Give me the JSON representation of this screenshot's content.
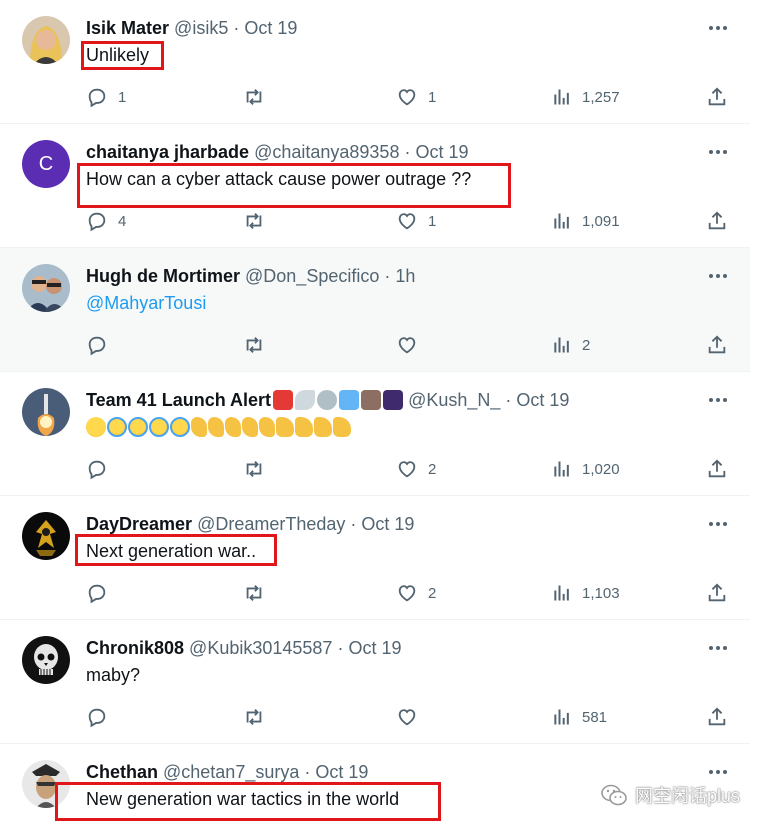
{
  "tweets": [
    {
      "name": "Isik Mater",
      "handle": "@isik5",
      "time": "Oct 19",
      "text": "Unlikely",
      "replies": "1",
      "retweets": "",
      "likes": "1",
      "views": "1,257",
      "avatar_icon": "profile-photo"
    },
    {
      "name": "chaitanya jharbade",
      "handle": "@chaitanya89358",
      "time": "Oct 19",
      "text": "How can a cyber attack cause power outrage ??",
      "replies": "4",
      "retweets": "",
      "likes": "1",
      "views": "1,091",
      "avatar_letter": "C",
      "avatar_color": "#5b2db2"
    },
    {
      "name": "Hugh de Mortimer",
      "handle": "@Don_Specifico",
      "time": "1h",
      "text": "@MahyarTousi",
      "replies": "",
      "retweets": "",
      "likes": "",
      "views": "2",
      "avatar_icon": "profile-photo"
    },
    {
      "name": "Team 41 Launch Alert",
      "name_emojis": [
        "rotating-light",
        "rocket",
        "satellite-dish",
        "satellite",
        "telescope",
        "milky-way"
      ],
      "handle": "@Kush_N_",
      "time": "Oct 19",
      "text_emojis": [
        "winking-face",
        "rofl",
        "rofl",
        "rofl",
        "rofl",
        "ok-hand",
        "ok-hand",
        "ok-hand",
        "ok-hand",
        "ok-hand",
        "thumbs-up",
        "thumbs-up",
        "thumbs-up",
        "thumbs-up"
      ],
      "replies": "",
      "retweets": "",
      "likes": "2",
      "views": "1,020",
      "avatar_icon": "rocket-launch-photo"
    },
    {
      "name": "DayDreamer",
      "handle": "@DreamerTheday",
      "time": "Oct 19",
      "text": "Next generation war..",
      "replies": "",
      "retweets": "",
      "likes": "2",
      "views": "1,103",
      "avatar_icon": "emblem"
    },
    {
      "name": "Chronik808",
      "handle": "@Kubik30145587",
      "time": "Oct 19",
      "text": "maby?",
      "replies": "",
      "retweets": "",
      "likes": "",
      "views": "581",
      "avatar_icon": "skull"
    },
    {
      "name": "Chethan",
      "handle": "@chetan7_surya",
      "time": "Oct 19",
      "text": "New generation war tactics in the world",
      "avatar_icon": "profile-photo"
    }
  ],
  "separator": "·",
  "watermark": "网空闲话plus",
  "colors": {
    "text": "#0f1419",
    "muted": "#536471",
    "link": "#1d9bf0",
    "highlight_box": "#e0161b",
    "hover_bg": "#f7f9f9"
  }
}
